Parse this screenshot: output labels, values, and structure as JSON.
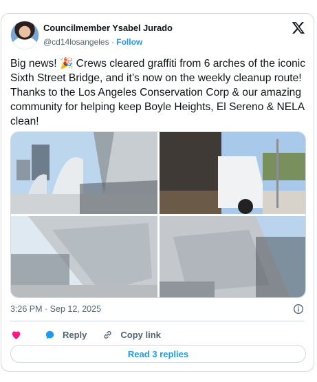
{
  "author": {
    "name": "Councilmember Ysabel Jurado",
    "handle": "@cd14losangeles",
    "separator": " · ",
    "follow_label": "Follow"
  },
  "tweet": {
    "text": "Big news! 🎉 Crews cleared graffiti from 6 arches of the iconic Sixth Street Bridge, and it’s now on the weekly cleanup route! Thanks to the Los Angeles Conservation Corp & our amazing community for helping keep Boyle Heights, El Sereno & NELA clean!",
    "timestamp": "3:26 PM · Sep 12, 2025"
  },
  "actions": {
    "like_icon": "heart-icon",
    "reply_label": "Reply",
    "copy_link_label": "Copy link"
  },
  "read_replies_label": "Read 3 replies",
  "colors": {
    "accent": "#1d9bf0",
    "like": "#f91880",
    "muted": "#536471",
    "border": "#cfd9de"
  }
}
